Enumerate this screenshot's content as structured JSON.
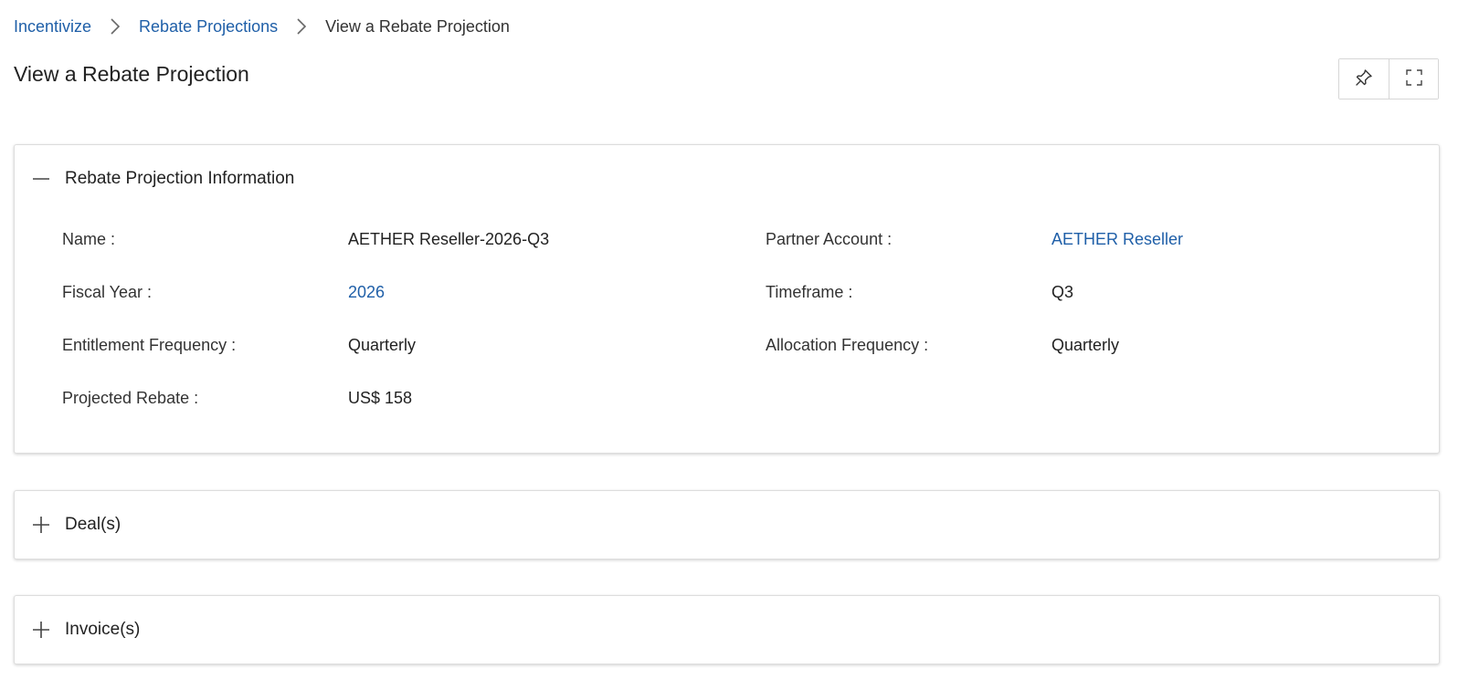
{
  "breadcrumb": {
    "items": [
      "Incentivize",
      "Rebate Projections"
    ],
    "current": "View a Rebate Projection"
  },
  "page": {
    "title": "View a Rebate Projection"
  },
  "actions": {
    "pin_icon": "pin-icon",
    "fullscreen_icon": "fullscreen-icon"
  },
  "sections": {
    "info": {
      "title": "Rebate Projection Information",
      "toggle": "collapse",
      "fields": {
        "name_label": "Name :",
        "name_value": "AETHER Reseller-2026-Q3",
        "partner_label": "Partner Account :",
        "partner_value": "AETHER Reseller",
        "fiscal_label": "Fiscal Year :",
        "fiscal_value": "2026",
        "timeframe_label": "Timeframe :",
        "timeframe_value": "Q3",
        "entitlement_label": "Entitlement Frequency :",
        "entitlement_value": "Quarterly",
        "allocation_label": "Allocation Frequency :",
        "allocation_value": "Quarterly",
        "rebate_label": "Projected Rebate :",
        "rebate_value": "US$ 158"
      }
    },
    "deals": {
      "title": "Deal(s)",
      "toggle": "expand"
    },
    "invoices": {
      "title": "Invoice(s)",
      "toggle": "expand"
    }
  },
  "colors": {
    "link": "#1f5fa8",
    "text": "#222222",
    "border": "#dddddd"
  }
}
